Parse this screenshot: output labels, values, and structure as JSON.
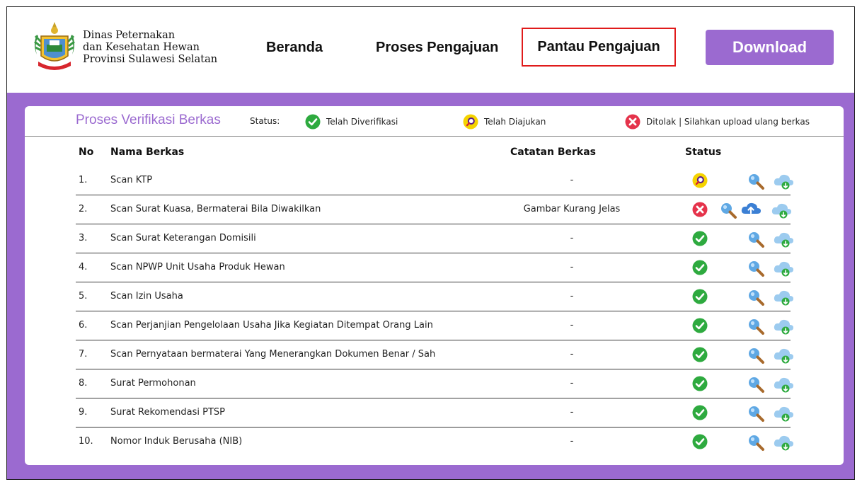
{
  "header": {
    "org_line1": "Dinas Peternakan",
    "org_line2": "dan Kesehatan Hewan",
    "org_line3": "Provinsi Sulawesi Selatan",
    "nav": [
      "Beranda",
      "Proses Pengajuan",
      "Pantau Pengajuan"
    ],
    "active_nav": "Pantau Pengajuan",
    "download_label": "Download",
    "logo_icon": "emblem-icon"
  },
  "colors": {
    "accent": "#9b6ad0",
    "verified": "#2eaa3f",
    "submitted": "#f5d300",
    "rejected": "#e5334b",
    "active_outline": "#e01b1b",
    "cloud": "#8fc7f0"
  },
  "card": {
    "title": "Proses Verifikasi Berkas",
    "status_label": "Status:",
    "legend": {
      "verified": "Telah Diverifikasi",
      "submitted": "Telah Diajukan",
      "rejected": "Ditolak | Silahkan upload ulang berkas"
    }
  },
  "table": {
    "headers": {
      "no": "No",
      "name": "Nama Berkas",
      "note": "Catatan Berkas",
      "status": "Status"
    },
    "rows": [
      {
        "no": "1.",
        "name": "Scan KTP",
        "note": "-",
        "status": "submitted"
      },
      {
        "no": "2.",
        "name": "Scan Surat Kuasa, Bermaterai Bila Diwakilkan",
        "note": "Gambar Kurang Jelas",
        "status": "rejected"
      },
      {
        "no": "3.",
        "name": "Scan Surat Keterangan Domisili",
        "note": "-",
        "status": "verified"
      },
      {
        "no": "4.",
        "name": "Scan NPWP Unit Usaha Produk Hewan",
        "note": "-",
        "status": "verified"
      },
      {
        "no": "5.",
        "name": "Scan Izin Usaha",
        "note": "-",
        "status": "verified"
      },
      {
        "no": "6.",
        "name": "Scan Perjanjian Pengelolaan Usaha Jika Kegiatan Ditempat Orang Lain",
        "note": "-",
        "status": "verified"
      },
      {
        "no": "7.",
        "name": "Scan Pernyataan bermaterai Yang Menerangkan Dokumen Benar / Sah",
        "note": "-",
        "status": "verified"
      },
      {
        "no": "8.",
        "name": "Surat Permohonan",
        "note": "-",
        "status": "verified"
      },
      {
        "no": "9.",
        "name": "Surat Rekomendasi PTSP",
        "note": "-",
        "status": "verified"
      },
      {
        "no": "10.",
        "name": "Nomor Induk Berusaha (NIB)",
        "note": "-",
        "status": "verified"
      }
    ]
  }
}
